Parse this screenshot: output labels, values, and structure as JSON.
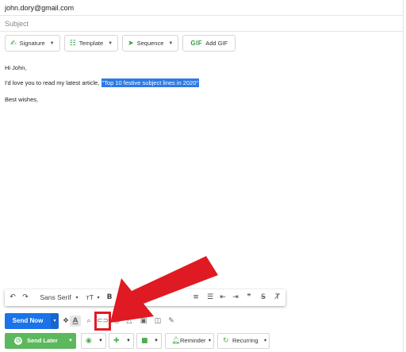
{
  "compose": {
    "to": "john.dory@gmail.com",
    "subject_placeholder": "Subject"
  },
  "toolbar": {
    "signature": "Signature",
    "template": "Template",
    "sequence": "Sequence",
    "gif_badge": "GIF",
    "add_gif": "Add GIF"
  },
  "body": {
    "greeting": "Hi John,",
    "line_prefix": "I'd love you to read my latest article, ",
    "link_text": "\"Top 10 festive subject lines in 2020\"",
    "signoff": "Best wishes,"
  },
  "format_bar": {
    "undo": "↶",
    "redo": "↷",
    "font": "Sans Serif",
    "font_caret": "▾",
    "size": "тT",
    "size_caret": "▾",
    "bold": "B",
    "italic": "I",
    "ol": "≡",
    "ul": "☰",
    "indent_less": "⇤",
    "indent_more": "⇥",
    "quote": "❞",
    "strike": "S̶",
    "clear": "T̸"
  },
  "send_row": {
    "send_now": "Send Now",
    "caret": "▾",
    "icons": [
      "dropbox-icon",
      "text-format-icon",
      "attach-icon",
      "link-icon",
      "emoji-icon",
      "drive-icon",
      "image-icon",
      "photo-lock-icon",
      "pen-icon"
    ]
  },
  "later_row": {
    "send_later": "Send Later",
    "reminder": "Reminder",
    "recurring": "Recurring",
    "caret": "▾"
  },
  "colors": {
    "highlight": "#2d7be5",
    "send_now": "#1a73e8",
    "send_later": "#5cb85c",
    "accent_green": "#2e9e3e",
    "callout_red": "#e01a22"
  }
}
